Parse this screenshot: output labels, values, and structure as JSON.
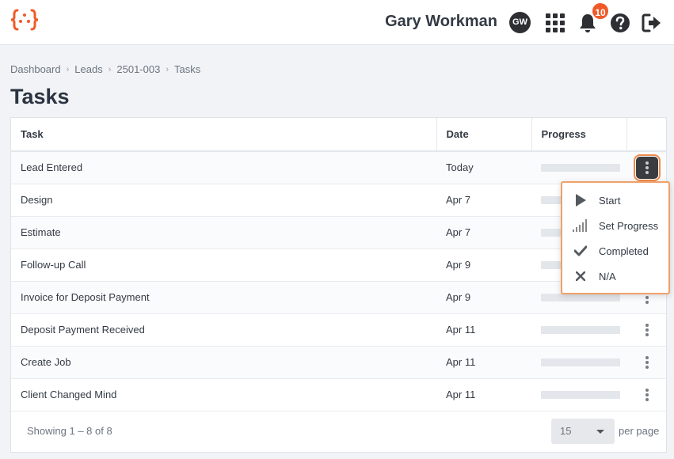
{
  "header": {
    "user_name": "Gary Workman",
    "avatar_initials": "GW",
    "notification_count": "10",
    "accent_color": "#f05a28"
  },
  "breadcrumb": [
    "Dashboard",
    "Leads",
    "2501-003",
    "Tasks"
  ],
  "page_title": "Tasks",
  "table": {
    "columns": [
      "Task",
      "Date",
      "Progress",
      ""
    ],
    "rows": [
      {
        "task": "Lead Entered",
        "date": "Today",
        "progress": 0
      },
      {
        "task": "Design",
        "date": "Apr 7",
        "progress": 0
      },
      {
        "task": "Estimate",
        "date": "Apr 7",
        "progress": 0
      },
      {
        "task": "Follow-up Call",
        "date": "Apr 9",
        "progress": 0
      },
      {
        "task": "Invoice for Deposit Payment",
        "date": "Apr 9",
        "progress": 0
      },
      {
        "task": "Deposit Payment Received",
        "date": "Apr 11",
        "progress": 0
      },
      {
        "task": "Create Job",
        "date": "Apr 11",
        "progress": 0
      },
      {
        "task": "Client Changed Mind",
        "date": "Apr 11",
        "progress": 0
      }
    ]
  },
  "footer": {
    "showing": "Showing 1 – 8 of 8",
    "per_page_value": "15",
    "per_page_label": "per page"
  },
  "menu": {
    "items": [
      {
        "label": "Start",
        "icon": "play-icon"
      },
      {
        "label": "Set Progress",
        "icon": "signal-bars-icon"
      },
      {
        "label": "Completed",
        "icon": "check-icon"
      },
      {
        "label": "N/A",
        "icon": "x-icon"
      }
    ]
  }
}
